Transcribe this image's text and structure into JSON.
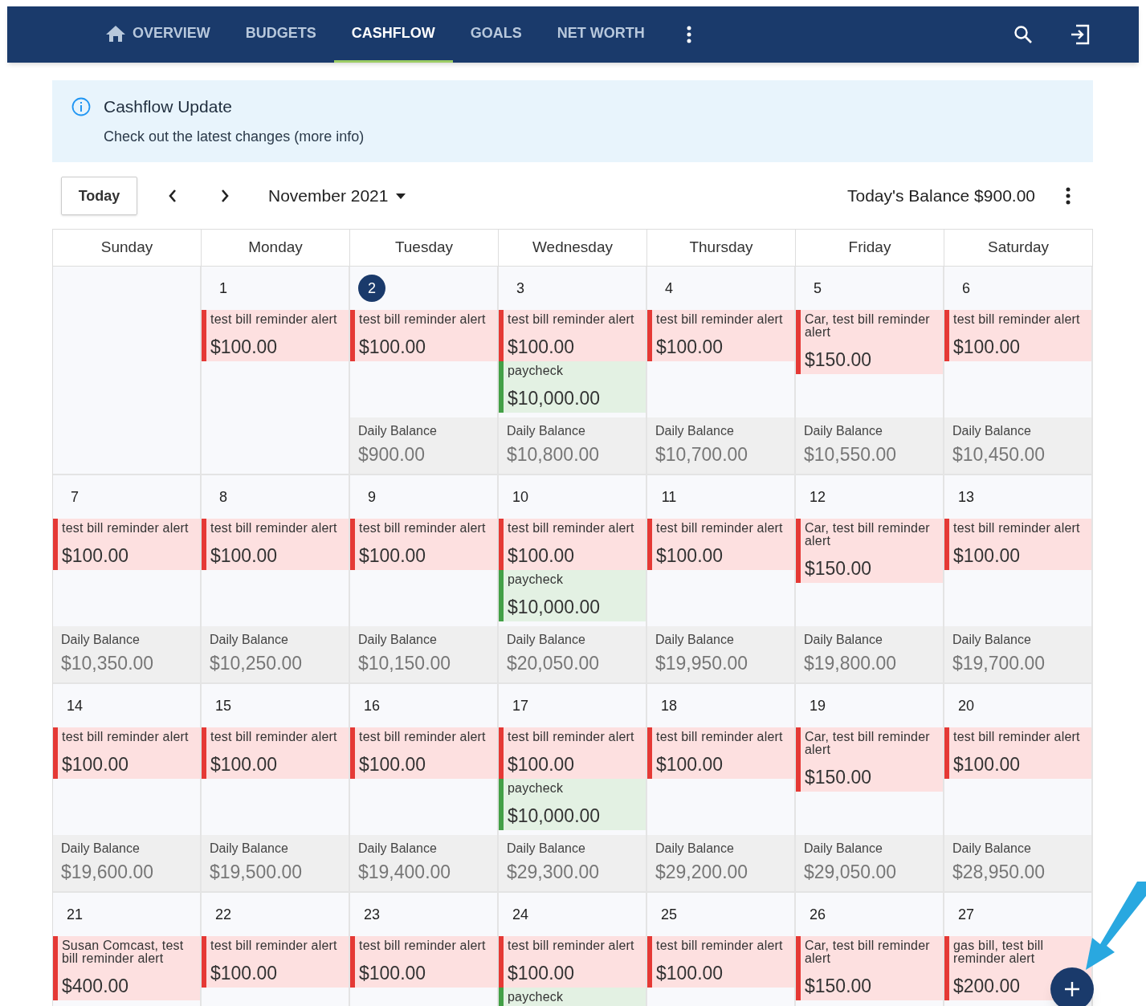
{
  "nav": {
    "tabs": [
      {
        "label": "OVERVIEW",
        "selected": false
      },
      {
        "label": "BUDGETS",
        "selected": false
      },
      {
        "label": "CASHFLOW",
        "selected": true
      },
      {
        "label": "GOALS",
        "selected": false
      },
      {
        "label": "NET WORTH",
        "selected": false
      }
    ]
  },
  "banner": {
    "title": "Cashflow Update",
    "text": "Check out the latest changes (more info)"
  },
  "toolbar": {
    "today_button": "Today",
    "month": "November 2021",
    "balance": "Today's Balance $900.00"
  },
  "calendar": {
    "weekdays": [
      "Sunday",
      "Monday",
      "Tuesday",
      "Wednesday",
      "Thursday",
      "Friday",
      "Saturday"
    ],
    "weeks": [
      [
        {
          "date": "1",
          "today": false,
          "events": [
            {
              "kind": "bill",
              "name": "test bill reminder alert",
              "amount": "$100.00"
            }
          ]
        },
        {
          "date": "2",
          "today": true,
          "events": [
            {
              "kind": "bill",
              "name": "test bill reminder alert",
              "amount": "$100.00"
            }
          ],
          "balance": {
            "label": "Daily Balance",
            "amount": "$900.00"
          }
        },
        {
          "date": "3",
          "today": false,
          "events": [
            {
              "kind": "bill",
              "name": "test bill reminder alert",
              "amount": "$100.00"
            },
            {
              "kind": "income",
              "name": "paycheck",
              "amount": "$10,000.00"
            }
          ],
          "balance": {
            "label": "Daily Balance",
            "amount": "$10,800.00"
          }
        },
        {
          "date": "4",
          "today": false,
          "events": [
            {
              "kind": "bill",
              "name": "test bill reminder alert",
              "amount": "$100.00"
            }
          ],
          "balance": {
            "label": "Daily Balance",
            "amount": "$10,700.00"
          }
        },
        {
          "date": "5",
          "today": false,
          "events": [
            {
              "kind": "bill",
              "name": "Car, test bill reminder alert",
              "amount": "$150.00"
            }
          ],
          "balance": {
            "label": "Daily Balance",
            "amount": "$10,550.00"
          }
        },
        {
          "date": "6",
          "today": false,
          "events": [
            {
              "kind": "bill",
              "name": "test bill reminder alert",
              "amount": "$100.00"
            }
          ],
          "balance": {
            "label": "Daily Balance",
            "amount": "$10,450.00"
          }
        }
      ],
      [
        {
          "date": "7",
          "today": false,
          "events": [
            {
              "kind": "bill",
              "name": "test bill reminder alert",
              "amount": "$100.00"
            }
          ],
          "balance": {
            "label": "Daily Balance",
            "amount": "$10,350.00"
          }
        },
        {
          "date": "8",
          "today": false,
          "events": [
            {
              "kind": "bill",
              "name": "test bill reminder alert",
              "amount": "$100.00"
            }
          ],
          "balance": {
            "label": "Daily Balance",
            "amount": "$10,250.00"
          }
        },
        {
          "date": "9",
          "today": false,
          "events": [
            {
              "kind": "bill",
              "name": "test bill reminder alert",
              "amount": "$100.00"
            }
          ],
          "balance": {
            "label": "Daily Balance",
            "amount": "$10,150.00"
          }
        },
        {
          "date": "10",
          "today": false,
          "events": [
            {
              "kind": "bill",
              "name": "test bill reminder alert",
              "amount": "$100.00"
            },
            {
              "kind": "income",
              "name": "paycheck",
              "amount": "$10,000.00"
            }
          ],
          "balance": {
            "label": "Daily Balance",
            "amount": "$20,050.00"
          }
        },
        {
          "date": "11",
          "today": false,
          "events": [
            {
              "kind": "bill",
              "name": "test bill reminder alert",
              "amount": "$100.00"
            }
          ],
          "balance": {
            "label": "Daily Balance",
            "amount": "$19,950.00"
          }
        },
        {
          "date": "12",
          "today": false,
          "events": [
            {
              "kind": "bill",
              "name": "Car, test bill reminder alert",
              "amount": "$150.00"
            }
          ],
          "balance": {
            "label": "Daily Balance",
            "amount": "$19,800.00"
          }
        },
        {
          "date": "13",
          "today": false,
          "events": [
            {
              "kind": "bill",
              "name": "test bill reminder alert",
              "amount": "$100.00"
            }
          ],
          "balance": {
            "label": "Daily Balance",
            "amount": "$19,700.00"
          }
        }
      ],
      [
        {
          "date": "14",
          "today": false,
          "events": [
            {
              "kind": "bill",
              "name": "test bill reminder alert",
              "amount": "$100.00"
            }
          ],
          "balance": {
            "label": "Daily Balance",
            "amount": "$19,600.00"
          }
        },
        {
          "date": "15",
          "today": false,
          "events": [
            {
              "kind": "bill",
              "name": "test bill reminder alert",
              "amount": "$100.00"
            }
          ],
          "balance": {
            "label": "Daily Balance",
            "amount": "$19,500.00"
          }
        },
        {
          "date": "16",
          "today": false,
          "events": [
            {
              "kind": "bill",
              "name": "test bill reminder alert",
              "amount": "$100.00"
            }
          ],
          "balance": {
            "label": "Daily Balance",
            "amount": "$19,400.00"
          }
        },
        {
          "date": "17",
          "today": false,
          "events": [
            {
              "kind": "bill",
              "name": "test bill reminder alert",
              "amount": "$100.00"
            },
            {
              "kind": "income",
              "name": "paycheck",
              "amount": "$10,000.00"
            }
          ],
          "balance": {
            "label": "Daily Balance",
            "amount": "$29,300.00"
          }
        },
        {
          "date": "18",
          "today": false,
          "events": [
            {
              "kind": "bill",
              "name": "test bill reminder alert",
              "amount": "$100.00"
            }
          ],
          "balance": {
            "label": "Daily Balance",
            "amount": "$29,200.00"
          }
        },
        {
          "date": "19",
          "today": false,
          "events": [
            {
              "kind": "bill",
              "name": "Car, test bill reminder alert",
              "amount": "$150.00"
            }
          ],
          "balance": {
            "label": "Daily Balance",
            "amount": "$29,050.00"
          }
        },
        {
          "date": "20",
          "today": false,
          "events": [
            {
              "kind": "bill",
              "name": "test bill reminder alert",
              "amount": "$100.00"
            }
          ],
          "balance": {
            "label": "Daily Balance",
            "amount": "$28,950.00"
          }
        }
      ],
      [
        {
          "date": "21",
          "today": false,
          "events": [
            {
              "kind": "bill",
              "name": "Susan Comcast, test bill reminder alert",
              "amount": "$400.00"
            }
          ]
        },
        {
          "date": "22",
          "today": false,
          "events": [
            {
              "kind": "bill",
              "name": "test bill reminder alert",
              "amount": "$100.00"
            }
          ]
        },
        {
          "date": "23",
          "today": false,
          "events": [
            {
              "kind": "bill",
              "name": "test bill reminder alert",
              "amount": "$100.00"
            }
          ]
        },
        {
          "date": "24",
          "today": false,
          "events": [
            {
              "kind": "bill",
              "name": "test bill reminder alert",
              "amount": "$100.00"
            },
            {
              "kind": "income",
              "name": "paycheck"
            }
          ]
        },
        {
          "date": "25",
          "today": false,
          "events": [
            {
              "kind": "bill",
              "name": "test bill reminder alert",
              "amount": "$100.00"
            }
          ]
        },
        {
          "date": "26",
          "today": false,
          "events": [
            {
              "kind": "bill",
              "name": "Car, test bill reminder alert",
              "amount": "$150.00"
            }
          ]
        },
        {
          "date": "27",
          "today": false,
          "events": [
            {
              "kind": "bill",
              "name": "gas bill, test bill reminder alert",
              "amount": "$200.00"
            }
          ]
        }
      ]
    ]
  }
}
